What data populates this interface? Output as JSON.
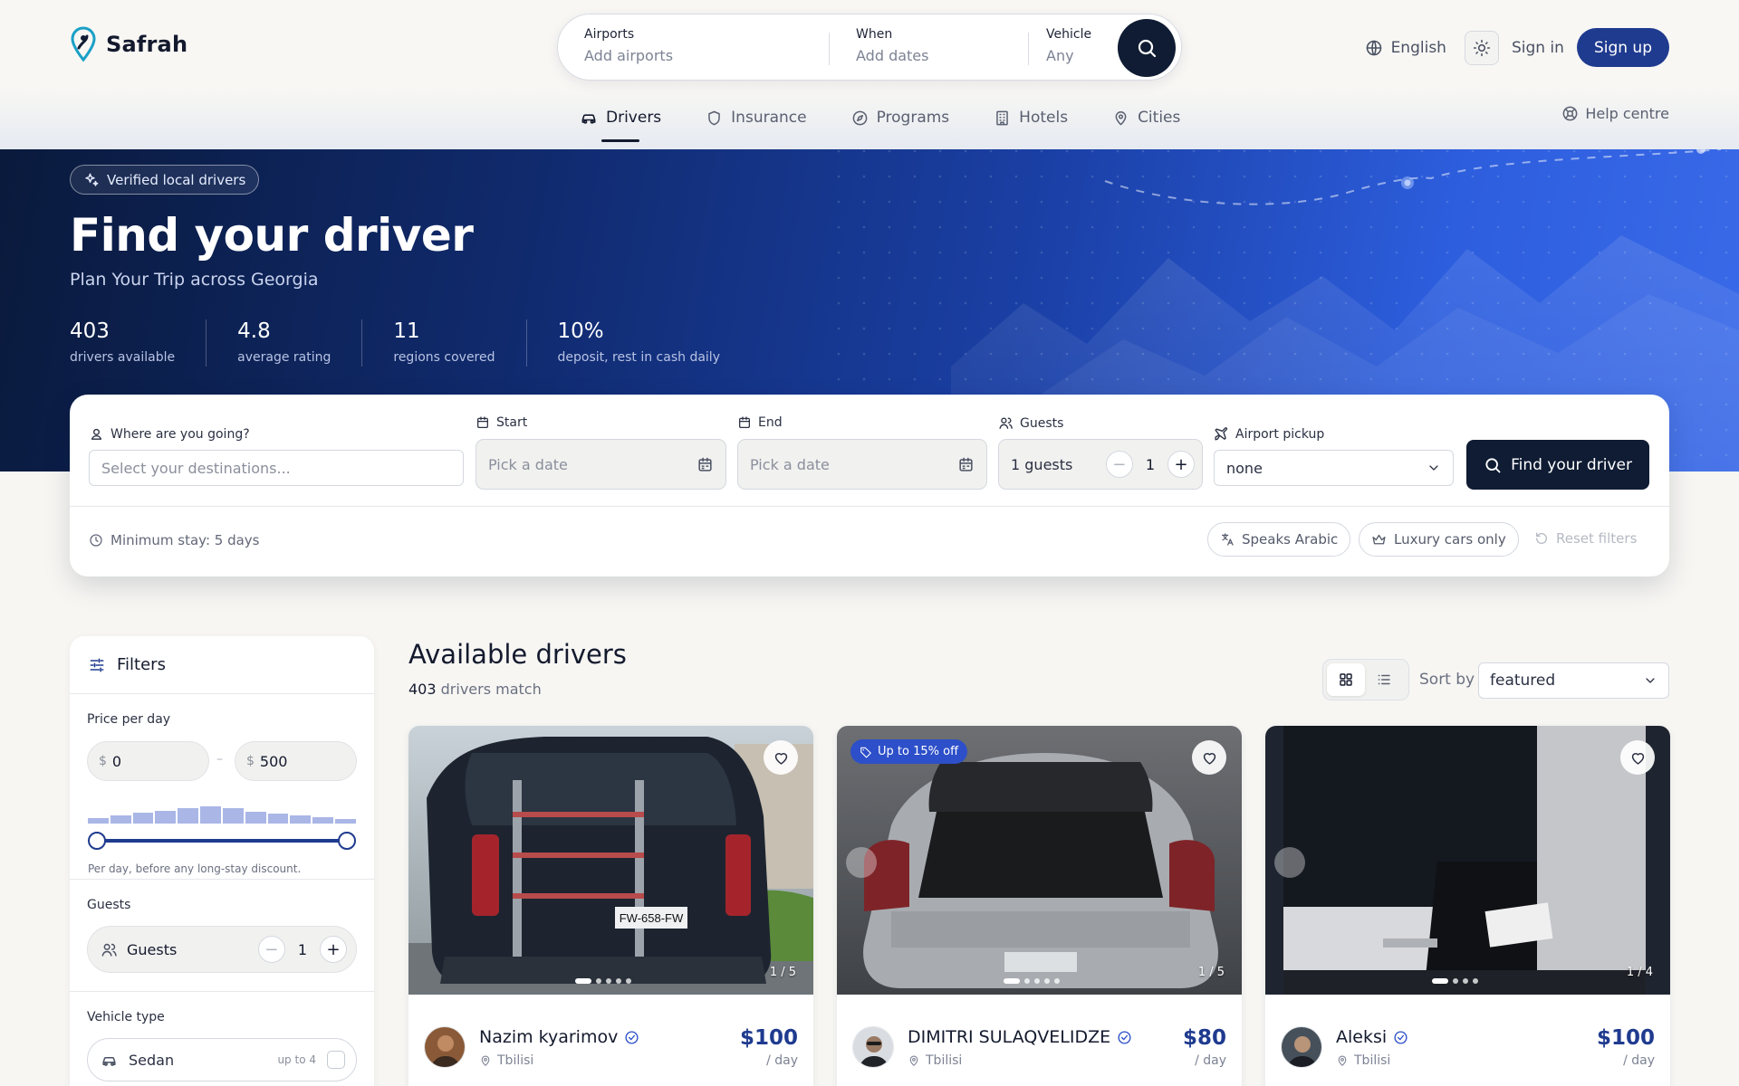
{
  "brand": {
    "name": "Safrah"
  },
  "header": {
    "search": {
      "airports_label": "Airports",
      "airports_value": "Add airports",
      "when_label": "When",
      "when_value": "Add dates",
      "vehicle_label": "Vehicle",
      "vehicle_value": "Any"
    },
    "language": "English",
    "sign_in": "Sign in",
    "sign_up": "Sign up"
  },
  "nav": {
    "items": [
      {
        "label": "Drivers",
        "icon": "car-icon",
        "active": true
      },
      {
        "label": "Insurance",
        "icon": "shield-icon"
      },
      {
        "label": "Programs",
        "icon": "compass-icon"
      },
      {
        "label": "Hotels",
        "icon": "building-icon"
      },
      {
        "label": "Cities",
        "icon": "map-pin-icon"
      }
    ],
    "help": "Help centre"
  },
  "hero": {
    "badge": "Verified local drivers",
    "title": "Find your driver",
    "subtitle": "Plan Your Trip across Georgia",
    "stats": [
      {
        "value": "403",
        "label": "drivers available"
      },
      {
        "value": "4.8",
        "label": "average rating"
      },
      {
        "value": "11",
        "label": "regions covered"
      },
      {
        "value": "10%",
        "label": "deposit, rest in cash daily"
      }
    ]
  },
  "booking": {
    "destination_label": "Where are you going?",
    "destination_placeholder": "Select your destinations...",
    "start_label": "Start",
    "start_placeholder": "Pick a date",
    "end_label": "End",
    "end_placeholder": "Pick a date",
    "guests_label": "Guests",
    "guests_text": "1 guests",
    "guests_count": "1",
    "airport_label": "Airport pickup",
    "airport_value": "none",
    "find_button": "Find your driver",
    "min_stay": "Minimum stay: 5 days",
    "chip_arabic": "Speaks Arabic",
    "chip_luxury": "Luxury cars only",
    "reset": "Reset filters"
  },
  "filters": {
    "title": "Filters",
    "price_label": "Price per day",
    "currency": "$",
    "price_min": "0",
    "price_max": "500",
    "price_range_selected": [
      0,
      1
    ],
    "price_note": "Per day, before any long-stay discount.",
    "guests_label": "Guests",
    "guests_field": "Guests",
    "guests_count": "1",
    "vehicle_label": "Vehicle type",
    "vehicle_option": "Sedan",
    "vehicle_capacity": "up to 4"
  },
  "results": {
    "title": "Available drivers",
    "count": "403",
    "count_suffix": "drivers match",
    "sort_label": "Sort by",
    "sort_value": "featured",
    "drivers": [
      {
        "name": "Nazim kyarimov",
        "city": "Tbilisi",
        "price": "$100",
        "per": "/ day",
        "photo_counter": "1 / 5",
        "offer": ""
      },
      {
        "name": "DIMITRI SULAQVELIDZE",
        "city": "Tbilisi",
        "price": "$80",
        "per": "/ day",
        "photo_counter": "1 / 5",
        "offer": "Up to 15% off"
      },
      {
        "name": "Aleksi",
        "city": "Tbilisi",
        "price": "$100",
        "per": "/ day",
        "photo_counter": "1 / 4",
        "offer": ""
      }
    ]
  },
  "colors": {
    "navy": "#0f1c33",
    "brand_blue": "#1f3b8f",
    "accent": "#2d4fc9"
  }
}
